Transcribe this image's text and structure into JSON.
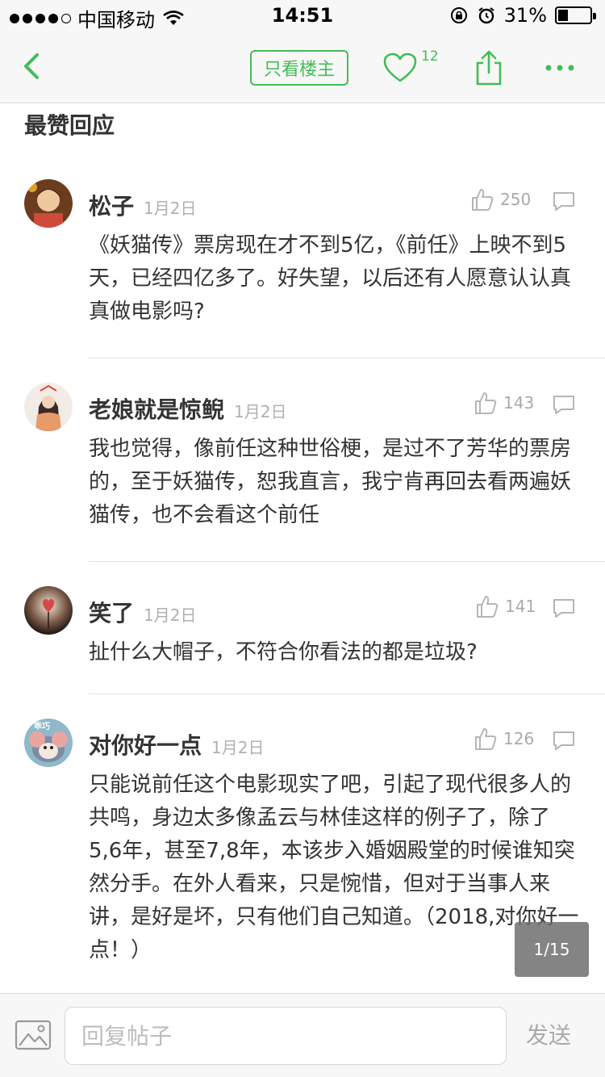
{
  "status_bar": {
    "carrier": "中国移动",
    "time": "14:51",
    "battery": "31%",
    "battery_level": 0.31
  },
  "nav": {
    "op_only_label": "只看楼主",
    "like_count": "12"
  },
  "section_title": "最赞回应",
  "comments": [
    {
      "name": "松子",
      "date": "1月2日",
      "likes": "250",
      "text": "《妖猫传》票房现在才不到5亿，《前任》上映不到5天，已经四亿多了。好失望，以后还有人愿意认认真真做电影吗?"
    },
    {
      "name": "老娘就是惊鲵",
      "date": "1月2日",
      "likes": "143",
      "text": "我也觉得，像前任这种世俗梗，是过不了芳华的票房的，至于妖猫传，恕我直言，我宁肯再回去看两遍妖猫传，也不会看这个前任"
    },
    {
      "name": "笑了",
      "date": "1月2日",
      "likes": "141",
      "text": "扯什么大帽子，不符合你看法的都是垃圾?"
    },
    {
      "name": "对你好一点",
      "date": "1月2日",
      "likes": "126",
      "avatar_text": "乖巧",
      "text": "只能说前任这个电影现实了吧，引起了现代很多人的共鸣，身边太多像孟云与林佳这样的例子了，除了5,6年，甚至7,8年，本该步入婚姻殿堂的时候谁知突然分手。在外人看来，只是惋惜，但对于当事人来讲，是好是坏，只有他们自己知道。（2018,对你好一点！）"
    }
  ],
  "page_indicator": "1/15",
  "bottom_bar": {
    "reply_placeholder": "回复帖子",
    "send_label": "发送"
  },
  "colors": {
    "accent": "#42bd56",
    "muted": "#aaaaaa",
    "text": "#333333"
  },
  "icons": [
    "back-icon",
    "heart-icon",
    "share-icon",
    "more-icon",
    "thumb-up-icon",
    "reply-bubble-icon",
    "image-icon",
    "wifi-icon",
    "lock-rotation-icon",
    "alarm-icon"
  ]
}
